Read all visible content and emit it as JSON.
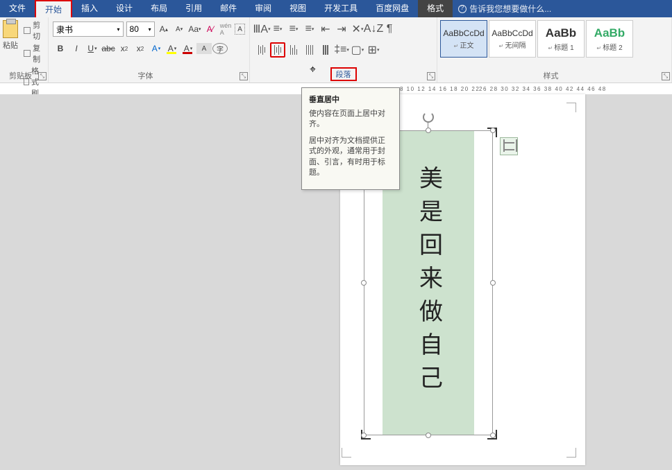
{
  "menubar": {
    "tabs": [
      "文件",
      "开始",
      "插入",
      "设计",
      "布局",
      "引用",
      "邮件",
      "审阅",
      "视图",
      "开发工具",
      "百度网盘"
    ],
    "format": "格式",
    "hint": "告诉我您想要做什么..."
  },
  "clipboard": {
    "cut": "剪切",
    "copy": "复制",
    "painter": "格式刷",
    "paste": "粘贴",
    "label": "剪贴板"
  },
  "font": {
    "name": "隶书",
    "size": "80",
    "label": "字体"
  },
  "paragraph": {
    "label": "段落"
  },
  "styles": {
    "label": "样式",
    "items": [
      {
        "preview": "AaBbCcDd",
        "name": "正文"
      },
      {
        "preview": "AaBbCcDd",
        "name": "无间隔"
      },
      {
        "preview": "AaBb",
        "name": "标题 1"
      },
      {
        "preview": "AaBb",
        "name": "标题 2"
      }
    ]
  },
  "tooltip": {
    "title": "垂直居中",
    "body1": "使内容在页面上居中对齐。",
    "body2": "居中对齐为文档提供正式的外观，通常用于封面、引言，有时用于标题。"
  },
  "ruler": {
    "left": "8 10 12 14 16 18 20 22",
    "right": "26 28 30 32 34 36 38 40 42 44 46 48"
  },
  "document": {
    "text": "美是回来做自己"
  }
}
